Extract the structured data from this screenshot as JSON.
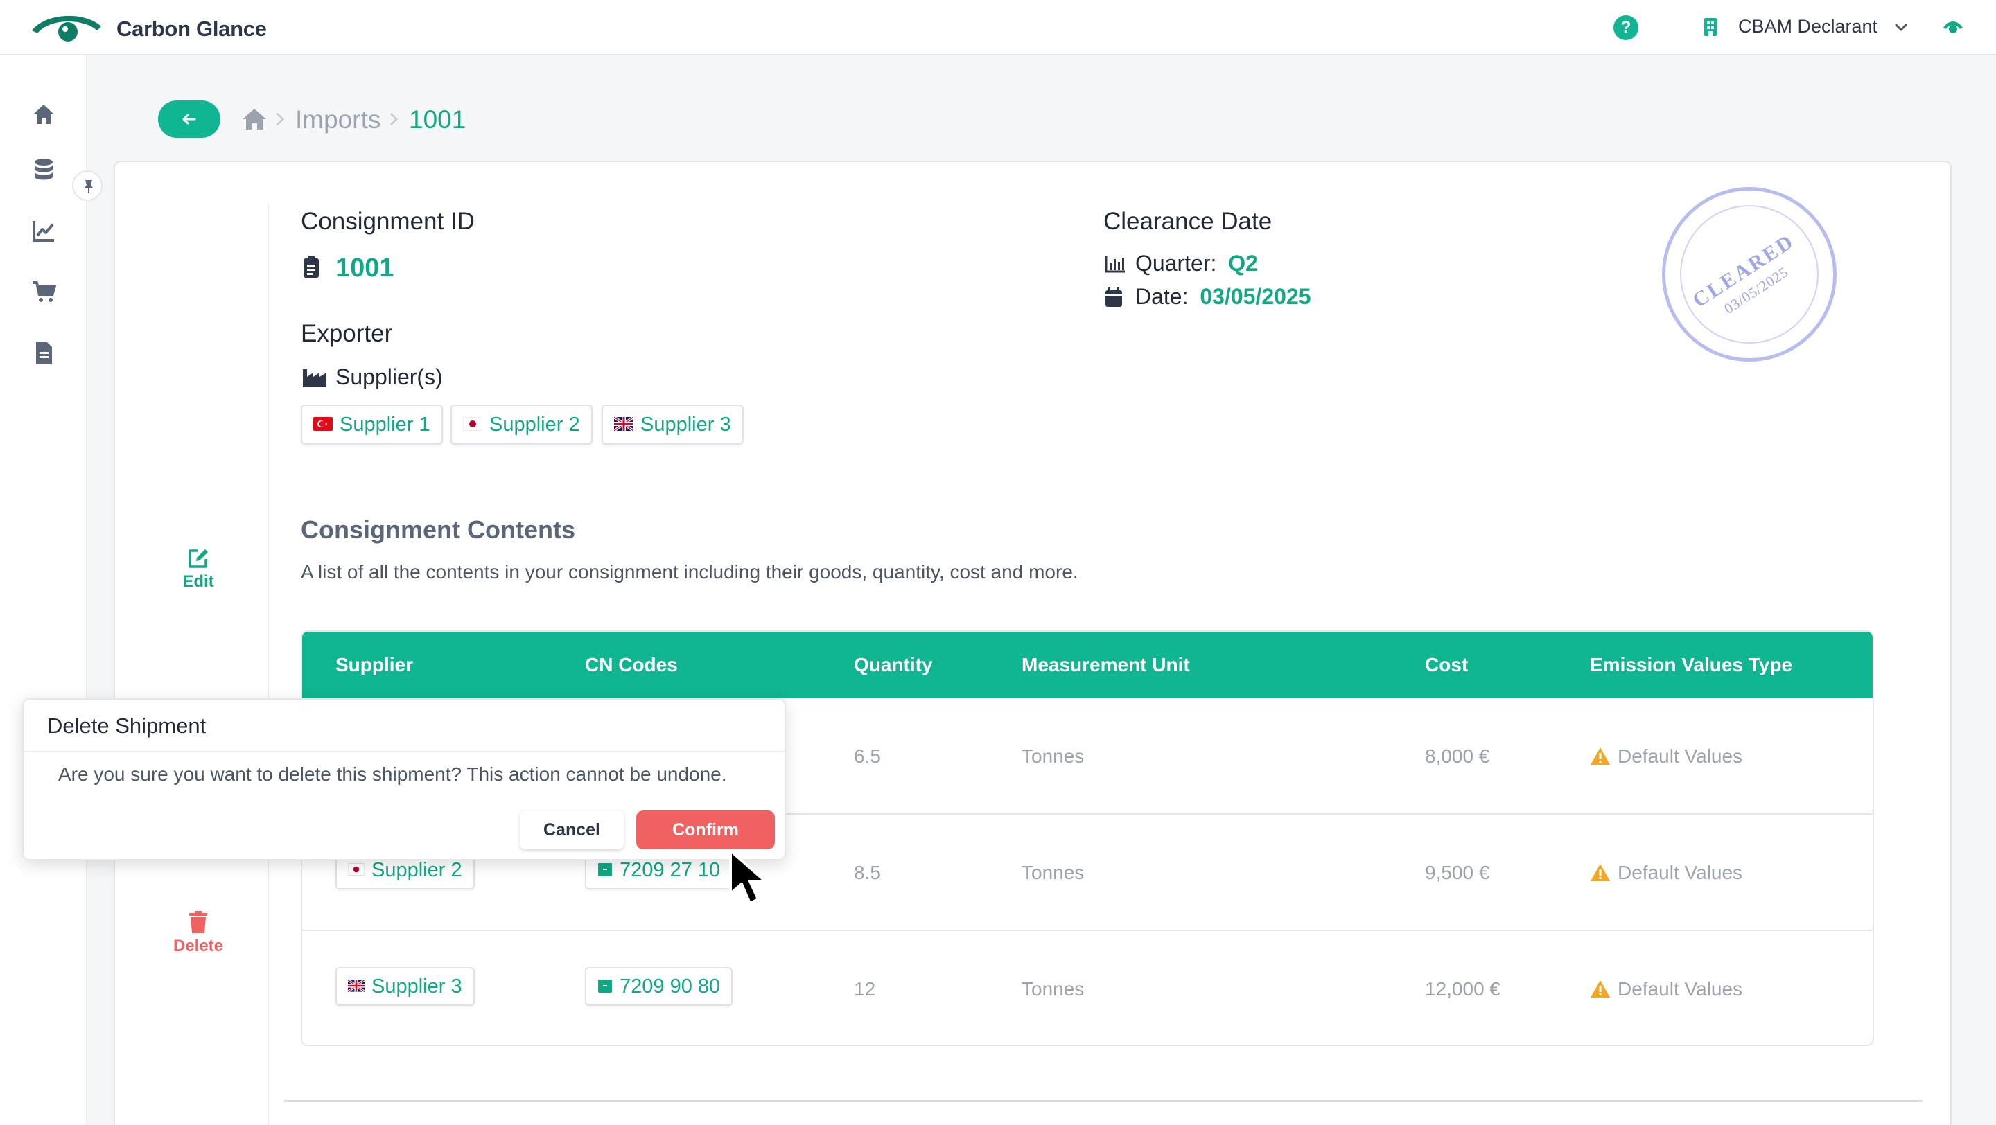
{
  "header": {
    "brand": "Carbon Glance",
    "role": "CBAM Declarant",
    "help_label": "?"
  },
  "sidebar": {
    "items": [
      "home-icon",
      "database-icon",
      "chart-line-icon",
      "cart-icon",
      "document-icon"
    ]
  },
  "breadcrumb": {
    "items": [
      "Imports",
      "1001"
    ]
  },
  "consignment": {
    "id_label": "Consignment ID",
    "id": "1001",
    "exporter_label": "Exporter",
    "suppliers_label": "Supplier(s)",
    "suppliers": [
      "Supplier 1",
      "Supplier 2",
      "Supplier 3"
    ],
    "clearance_label": "Clearance Date",
    "quarter_label": "Quarter:",
    "quarter": "Q2",
    "date_label": "Date:",
    "date": "03/05/2025"
  },
  "stamp": {
    "status": "CLEARED",
    "date": "03/05/2025",
    "color": "#b7bdf0"
  },
  "actions": {
    "edit": "Edit",
    "delete": "Delete"
  },
  "contents": {
    "title": "Consignment Contents",
    "description": "A list of all the contents in your consignment including their goods, quantity, cost and more.",
    "columns": [
      "Supplier",
      "CN Codes",
      "Quantity",
      "Measurement Unit",
      "Cost",
      "Emission Values Type"
    ],
    "rows": [
      {
        "supplier": "",
        "cn_code": "",
        "quantity": "6.5",
        "unit": "Tonnes",
        "cost": "8,000 €",
        "emission": "Default Values"
      },
      {
        "supplier": "Supplier 2",
        "cn_code": "7209 27 10",
        "quantity": "8.5",
        "unit": "Tonnes",
        "cost": "9,500 €",
        "emission": "Default Values"
      },
      {
        "supplier": "Supplier 3",
        "cn_code": "7209 90 80",
        "quantity": "12",
        "unit": "Tonnes",
        "cost": "12,000 €",
        "emission": "Default Values"
      }
    ]
  },
  "dialog": {
    "title": "Delete Shipment",
    "message": "Are you sure you want to delete this shipment? This action cannot be undone.",
    "cancel": "Cancel",
    "confirm": "Confirm"
  },
  "colors": {
    "accent": "#10b591",
    "danger": "#f06262",
    "warning": "#f5a623"
  }
}
